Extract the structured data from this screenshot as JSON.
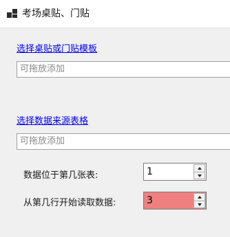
{
  "window": {
    "title": "考场桌贴、门贴",
    "icon": "app-window-icon"
  },
  "template_section": {
    "link_label": "选择桌贴或门贴模板",
    "drop_placeholder": "可拖放添加"
  },
  "source_section": {
    "link_label": "选择数据来源表格",
    "drop_placeholder": "可拖放添加"
  },
  "sheet_index": {
    "label": "数据位于第几张表:",
    "value": "1"
  },
  "start_row": {
    "label": "从第几行开始读取数据:",
    "value": "3",
    "highlight_color": "#f08080"
  },
  "colors": {
    "link": "#0000ee",
    "background": "#f0f0f0",
    "titlebar": "#ffffff"
  }
}
